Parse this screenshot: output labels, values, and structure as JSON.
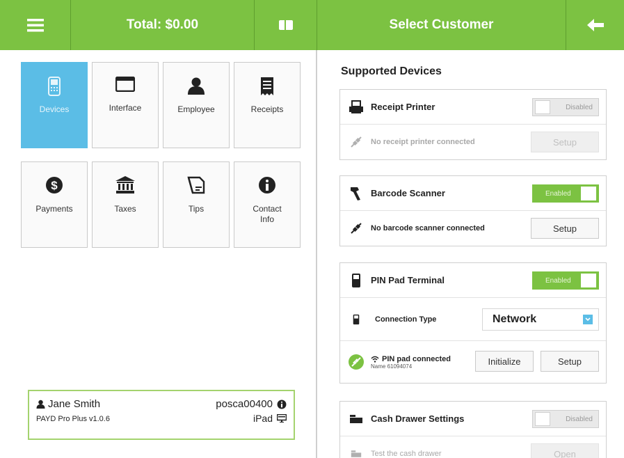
{
  "header": {
    "total": "Total: $0.00",
    "select_customer": "Select Customer"
  },
  "tiles": [
    {
      "label": "Devices",
      "icon": "device-icon",
      "active": true
    },
    {
      "label": "Interface",
      "icon": "window-icon",
      "active": false
    },
    {
      "label": "Employee",
      "icon": "person-icon",
      "active": false
    },
    {
      "label": "Receipts",
      "icon": "receipt-icon",
      "active": false
    },
    {
      "label": "Payments",
      "icon": "dollar-icon",
      "active": false
    },
    {
      "label": "Taxes",
      "icon": "bank-icon",
      "active": false
    },
    {
      "label": "Tips",
      "icon": "tip-icon",
      "active": false
    },
    {
      "label": "Contact Info",
      "icon": "info-icon",
      "active": false
    }
  ],
  "user": {
    "name": "Jane Smith",
    "app_version": "PAYD Pro Plus v1.0.6",
    "station": "posca00400",
    "device": "iPad"
  },
  "devices": {
    "title": "Supported Devices",
    "receipt_printer": {
      "title": "Receipt Printer",
      "toggle": "Disabled",
      "status": "No receipt printer connected",
      "setup": "Setup"
    },
    "barcode_scanner": {
      "title": "Barcode Scanner",
      "toggle": "Enabled",
      "status": "No barcode scanner connected",
      "setup": "Setup"
    },
    "pin_pad": {
      "title": "PIN Pad Terminal",
      "toggle": "Enabled",
      "connection_label": "Connection Type",
      "connection_value": "Network",
      "status": "PIN pad connected",
      "device_name": "Name 61094074",
      "initialize": "Initialize",
      "setup": "Setup"
    },
    "cash_drawer": {
      "title": "Cash Drawer Settings",
      "toggle": "Disabled",
      "status": "Test the cash drawer",
      "open": "Open"
    }
  },
  "colors": {
    "accent_green": "#7cc242",
    "active_blue": "#5bbde6"
  }
}
